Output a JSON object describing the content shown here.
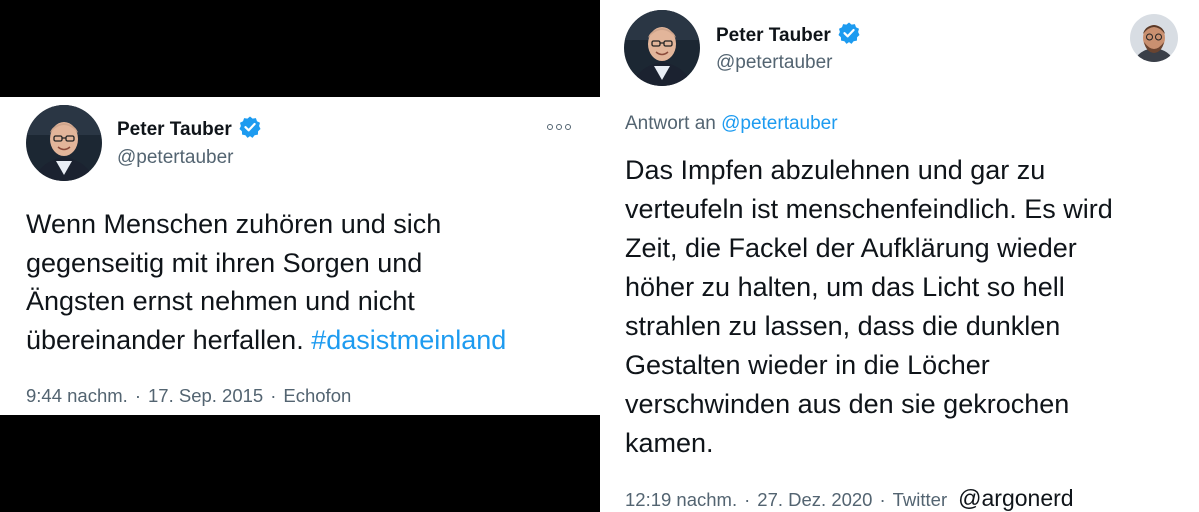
{
  "left_tweet": {
    "display_name": "Peter Tauber",
    "handle": "@petertauber",
    "text_lines": [
      "Wenn Menschen zuhören und sich",
      "gegenseitig mit ihren Sorgen und",
      "Ängsten ernst nehmen und nicht",
      "übereinander herfallen. "
    ],
    "hashtag": "#dasistmeinland",
    "time": "9:44 nachm.",
    "date": "17. Sep. 2015",
    "source": "Echofon",
    "separator": "·"
  },
  "right_tweet": {
    "display_name": "Peter Tauber",
    "handle": "@petertauber",
    "reply_prefix": "Antwort an",
    "reply_handle": "@petertauber",
    "text_lines": [
      "Das Impfen abzulehnen und gar zu",
      "verteufeln ist menschenfeindlich. Es wird",
      "Zeit, die Fackel der Aufklärung wieder",
      "höher zu halten, um das Licht so hell",
      "strahlen zu lassen, dass die dunklen",
      "Gestalten wieder in die Löcher",
      "verschwinden aus den sie gekrochen",
      "kamen."
    ],
    "time": "12:19 nachm.",
    "date": "27. Dez. 2020",
    "source": "Twitter",
    "separator": "·",
    "watermark": "@argonerd"
  },
  "colors": {
    "link": "#1d9bf0",
    "text": "#0f1419",
    "muted": "#536471",
    "background_left": "#000000"
  },
  "icons": [
    "verified-badge-icon",
    "more-options-icon",
    "avatar"
  ]
}
